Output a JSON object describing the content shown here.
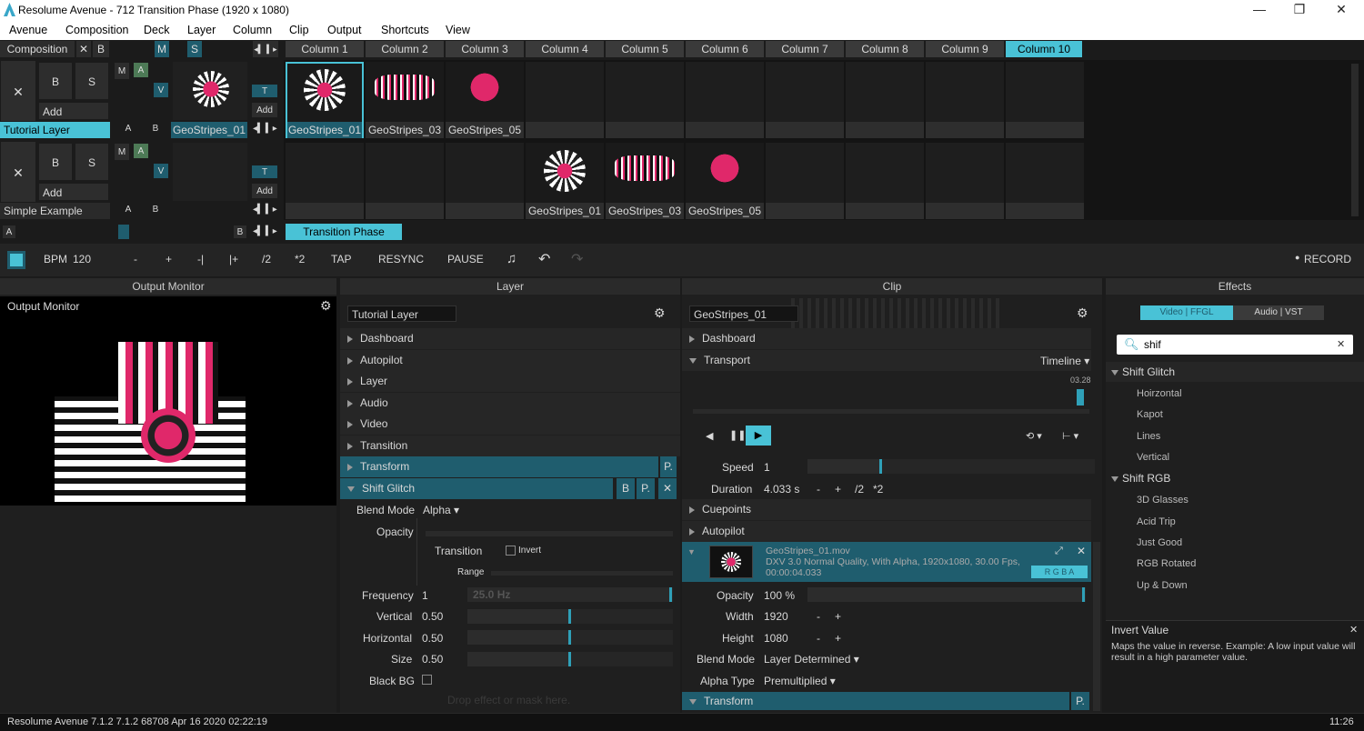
{
  "window": {
    "title": "Resolume Avenue - 712 Transition Phase (1920 x 1080)",
    "min": "—",
    "max": "❐",
    "close": "✕"
  },
  "menu": [
    "Avenue",
    "Composition",
    "Deck",
    "Layer",
    "Column",
    "Clip",
    "Output",
    "Shortcuts",
    "View"
  ],
  "comp": {
    "label": "Composition",
    "x": "✕",
    "b": "B",
    "m": "M",
    "s": "S"
  },
  "columns": [
    "Column 1",
    "Column 2",
    "Column 3",
    "Column 4",
    "Column 5",
    "Column 6",
    "Column 7",
    "Column 8",
    "Column 9",
    "Column 10"
  ],
  "layer1": {
    "x": "✕",
    "b": "B",
    "s": "S",
    "add": "Add",
    "name": "Tutorial Layer",
    "a": "A",
    "bb": "B",
    "m": "M",
    "aa": "A",
    "v": "V",
    "t": "T",
    "add2": "Add",
    "thumb": "GeoStripes_01"
  },
  "layer2": {
    "x": "✕",
    "b": "B",
    "s": "S",
    "add": "Add",
    "name": "Simple Example",
    "a": "A",
    "bb": "B",
    "m": "M",
    "aa": "A",
    "v": "V",
    "t": "T",
    "add2": "Add"
  },
  "clips1": [
    "GeoStripes_01",
    "GeoStripes_03",
    "GeoStripes_05"
  ],
  "clips2": [
    "GeoStripes_01",
    "GeoStripes_03",
    "GeoStripes_05"
  ],
  "deck": {
    "a": "A",
    "b": "B",
    "name": "Transition Phase"
  },
  "transport": {
    "bpm_label": "BPM",
    "bpm": "120",
    "minus": "-",
    "plus": "+",
    "nudge_minus": "-|",
    "nudge_plus": "|+",
    "half": "/2",
    "double": "*2",
    "tap": "TAP",
    "resync": "RESYNC",
    "pause": "PAUSE",
    "record": "RECORD"
  },
  "output": {
    "header": "Output Monitor",
    "title": "Output Monitor"
  },
  "layer": {
    "header": "Layer",
    "name": "Tutorial Layer",
    "sections": [
      "Dashboard",
      "Autopilot",
      "Layer",
      "Audio",
      "Video",
      "Transition"
    ],
    "transform": "Transform",
    "p": "P.",
    "shift": "Shift Glitch",
    "b": "B",
    "x": "✕",
    "blend_label": "Blend Mode",
    "blend": "Alpha",
    "opacity": "Opacity",
    "transition": "Transition",
    "invert": "Invert",
    "range": "Range",
    "freq_label": "Frequency",
    "freq": "1",
    "freq_hz": "25.0 Hz",
    "vert_label": "Vertical",
    "vert": "0.50",
    "horiz_label": "Horizontal",
    "horiz": "0.50",
    "size_label": "Size",
    "size": "0.50",
    "blackbg": "Black BG",
    "drop": "Drop effect or mask here."
  },
  "clip": {
    "header": "Clip",
    "name": "GeoStripes_01",
    "dashboard": "Dashboard",
    "transport": "Transport",
    "timeline": "Timeline",
    "time": "03.28",
    "speed_label": "Speed",
    "speed": "1",
    "dur_label": "Duration",
    "dur": "4.033 s",
    "dm": "-",
    "dp": "+",
    "dh": "/2",
    "dd": "*2",
    "cuepoints": "Cuepoints",
    "autopilot": "Autopilot",
    "file": "GeoStripes_01.mov",
    "info": "DXV 3.0 Normal Quality, With Alpha, 1920x1080, 30.00 Fps, 00:00:04.033",
    "rgba": "R G B A",
    "opacity_label": "Opacity",
    "opacity": "100 %",
    "width_label": "Width",
    "width": "1920",
    "height_label": "Height",
    "height": "1080",
    "wm": "-",
    "wp": "+",
    "hm": "-",
    "hp": "+",
    "blend_label": "Blend Mode",
    "blend": "Layer Determined",
    "alpha_label": "Alpha Type",
    "alpha": "Premultiplied",
    "transform": "Transform",
    "p": "P."
  },
  "effects": {
    "header": "Effects",
    "tab_video": "Video | FFGL",
    "tab_audio": "Audio | VST",
    "search": "shif",
    "clear": "✕",
    "groups": [
      {
        "name": "Shift Glitch",
        "items": [
          "Hoirzontal",
          "Kapot",
          "Lines",
          "Vertical"
        ]
      },
      {
        "name": "Shift RGB",
        "items": [
          "3D Glasses",
          "Acid Trip",
          "Just Good",
          "RGB Rotated",
          "Up & Down"
        ]
      }
    ],
    "help_title": "Invert Value",
    "help_text": "Maps the value in reverse. Example: A low input value will result in a high parameter value.",
    "help_close": "✕"
  },
  "status": {
    "left": "Resolume Avenue 7.1.2 7.1.2 68708 Apr 16 2020 02:22:19",
    "right": "11:26"
  },
  "colors": {
    "accent": "#49c2d6",
    "pink": "#e0286a",
    "teal": "#1f5d6e"
  }
}
